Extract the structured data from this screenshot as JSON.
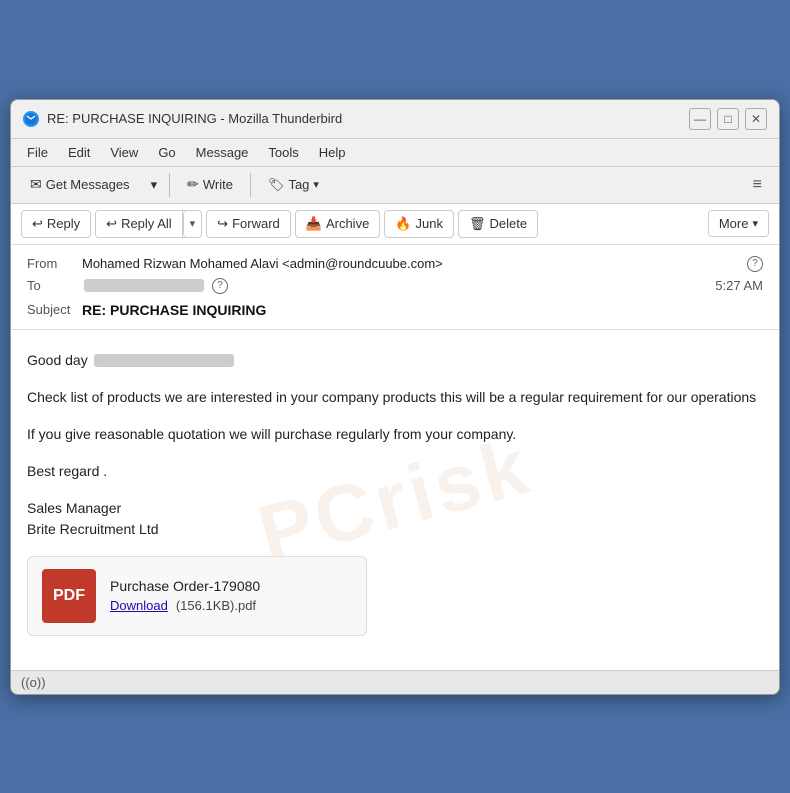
{
  "window": {
    "title": "RE: PURCHASE INQUIRING - Mozilla Thunderbird",
    "icon_label": "TB"
  },
  "titlebar": {
    "minimize_label": "—",
    "maximize_label": "□",
    "close_label": "✕"
  },
  "menubar": {
    "items": [
      "File",
      "Edit",
      "View",
      "Go",
      "Message",
      "Tools",
      "Help"
    ]
  },
  "toolbar": {
    "get_messages_label": "Get Messages",
    "write_label": "Write",
    "tag_label": "Tag"
  },
  "actions": {
    "reply_label": "Reply",
    "reply_all_label": "Reply All",
    "forward_label": "Forward",
    "archive_label": "Archive",
    "junk_label": "Junk",
    "delete_label": "Delete",
    "more_label": "More"
  },
  "email": {
    "from_label": "From",
    "from_value": "Mohamed Rizwan Mohamed Alavi <admin@roundcuube.com>",
    "to_label": "To",
    "to_blurred": true,
    "time": "5:27 AM",
    "subject_label": "Subject",
    "subject_value": "RE: PURCHASE INQUIRING"
  },
  "body": {
    "greeting": "Good day",
    "paragraph1": "Check list of products we are interested in your company products this will be a regular requirement for our operations",
    "paragraph2": "If you give reasonable quotation we will purchase regularly from your company.",
    "closing": "Best regard .",
    "signature_line1": "Sales Manager",
    "signature_line2": "Brite Recruitment Ltd"
  },
  "attachment": {
    "icon_text": "PDF",
    "filename": "Purchase Order-179080",
    "download_label": "Download",
    "size": "(156.1KB).pdf"
  },
  "statusbar": {
    "signal_icon": "((o))"
  },
  "icons": {
    "reply": "↩",
    "forward": "↪",
    "archive": "🗄",
    "junk": "🔥",
    "delete": "🗑",
    "chevron_down": "▾",
    "get_messages": "✉",
    "write": "✏",
    "tag": "🏷",
    "menu": "≡",
    "privacy": "?"
  }
}
